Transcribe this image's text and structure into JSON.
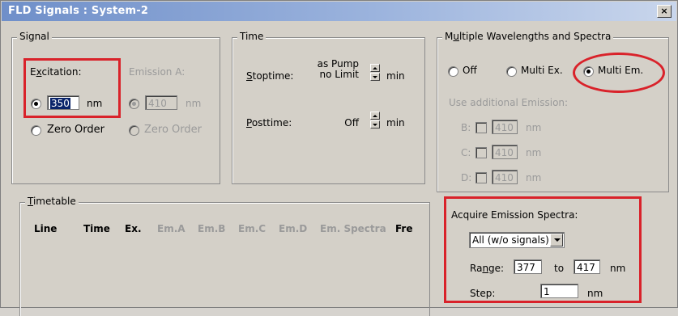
{
  "window": {
    "title": "FLD Signals : System-2",
    "close_label": "×"
  },
  "signal": {
    "legend": "Signal",
    "excitation_label": "Excitation:",
    "excitation_value": "350",
    "excitation_unit": "nm",
    "zero_order_label": "Zero Order",
    "emission_label": "Emission A:",
    "emission_value": "410",
    "emission_unit": "nm",
    "emission_zero_order_label": "Zero Order"
  },
  "time": {
    "legend": "Time",
    "stoptime_label": "Stoptime:",
    "stoptime_value_line1": "as Pump",
    "stoptime_value_line2": "no Limit",
    "stoptime_unit": "min",
    "posttime_label": "Posttime:",
    "posttime_value": "Off",
    "posttime_unit": "min"
  },
  "multi": {
    "legend": "Multiple Wavelengths and Spectra",
    "off_label": "Off",
    "multi_ex_label": "Multi Ex.",
    "multi_em_label": "Multi Em.",
    "use_additional_label": "Use additional Emission:",
    "b_label": "B:",
    "b_value": "410",
    "c_label": "C:",
    "c_value": "410",
    "d_label": "D:",
    "d_value": "410",
    "unit": "nm"
  },
  "acquire": {
    "label": "Acquire Emission Spectra:",
    "select_value": "All (w/o signals)",
    "range_label": "Range:",
    "range_from": "377",
    "range_to_label": "to",
    "range_to": "417",
    "range_unit": "nm",
    "step_label": "Step:",
    "step_value": "1",
    "step_unit": "nm"
  },
  "timetable": {
    "legend": "Timetable",
    "columns": [
      "Line",
      "Time",
      "Ex.",
      "Em.A",
      "Em.B",
      "Em.C",
      "Em.D",
      "Em. Spectra",
      "Fre"
    ]
  },
  "colors": {
    "highlight": "#d9222a",
    "title_bar": "#6f8fc9"
  }
}
